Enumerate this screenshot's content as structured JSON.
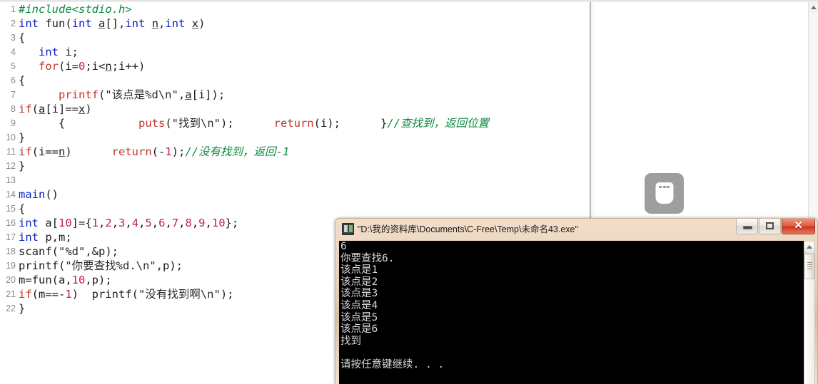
{
  "editor": {
    "name": "code-editor",
    "language": "C",
    "lines": [
      {
        "n": "1",
        "tokens": [
          {
            "t": "#include<stdio.h>",
            "c": "cmt"
          }
        ]
      },
      {
        "n": "2",
        "tokens": [
          {
            "t": "int",
            "c": "kw"
          },
          {
            "t": " fun(",
            "c": "ctext"
          },
          {
            "t": "int",
            "c": "kw"
          },
          {
            "t": " ",
            "c": "ctext"
          },
          {
            "t": "a",
            "c": "und"
          },
          {
            "t": "[],",
            "c": "ctext"
          },
          {
            "t": "int",
            "c": "kw"
          },
          {
            "t": " ",
            "c": "ctext"
          },
          {
            "t": "n",
            "c": "und"
          },
          {
            "t": ",",
            "c": "ctext"
          },
          {
            "t": "int",
            "c": "kw"
          },
          {
            "t": " ",
            "c": "ctext"
          },
          {
            "t": "x",
            "c": "und"
          },
          {
            "t": ")",
            "c": "ctext"
          }
        ]
      },
      {
        "n": "3",
        "tokens": [
          {
            "t": "{",
            "c": "ctext"
          }
        ]
      },
      {
        "n": "4",
        "tokens": [
          {
            "t": "   ",
            "c": "ctext"
          },
          {
            "t": "int",
            "c": "kw"
          },
          {
            "t": " i;",
            "c": "ctext"
          }
        ]
      },
      {
        "n": "5",
        "tokens": [
          {
            "t": "   ",
            "c": "ctext"
          },
          {
            "t": "for",
            "c": "kwr"
          },
          {
            "t": "(i=",
            "c": "ctext"
          },
          {
            "t": "0",
            "c": "num"
          },
          {
            "t": ";i<",
            "c": "ctext"
          },
          {
            "t": "n",
            "c": "und"
          },
          {
            "t": ";i++)",
            "c": "ctext"
          }
        ]
      },
      {
        "n": "6",
        "tokens": [
          {
            "t": "{",
            "c": "ctext"
          }
        ]
      },
      {
        "n": "7",
        "tokens": [
          {
            "t": "      ",
            "c": "ctext"
          },
          {
            "t": "printf",
            "c": "kwr"
          },
          {
            "t": "(",
            "c": "ctext"
          },
          {
            "t": "\"该点是%d\\n\"",
            "c": "str"
          },
          {
            "t": ",",
            "c": "ctext"
          },
          {
            "t": "a",
            "c": "und"
          },
          {
            "t": "[i]);",
            "c": "ctext"
          }
        ]
      },
      {
        "n": "8",
        "tokens": [
          {
            "t": "if",
            "c": "kwr"
          },
          {
            "t": "(",
            "c": "ctext"
          },
          {
            "t": "a",
            "c": "und"
          },
          {
            "t": "[i]==",
            "c": "ctext"
          },
          {
            "t": "x",
            "c": "und"
          },
          {
            "t": ")",
            "c": "ctext"
          }
        ]
      },
      {
        "n": "9",
        "tokens": [
          {
            "t": "      {           ",
            "c": "ctext"
          },
          {
            "t": "puts",
            "c": "kwr"
          },
          {
            "t": "(",
            "c": "ctext"
          },
          {
            "t": "\"找到\\n\"",
            "c": "str"
          },
          {
            "t": ");      ",
            "c": "ctext"
          },
          {
            "t": "return",
            "c": "kwr"
          },
          {
            "t": "(i);      ",
            "c": "ctext"
          },
          {
            "t": "}",
            "c": "ctext"
          },
          {
            "t": "//查找到，返回位置",
            "c": "cmt"
          }
        ]
      },
      {
        "n": "10",
        "tokens": [
          {
            "t": "}",
            "c": "ctext"
          }
        ]
      },
      {
        "n": "11",
        "tokens": [
          {
            "t": "if",
            "c": "kwr"
          },
          {
            "t": "(i==",
            "c": "ctext"
          },
          {
            "t": "n",
            "c": "und"
          },
          {
            "t": ")      ",
            "c": "ctext"
          },
          {
            "t": "return",
            "c": "kwr"
          },
          {
            "t": "(-",
            "c": "ctext"
          },
          {
            "t": "1",
            "c": "num"
          },
          {
            "t": ");",
            "c": "ctext"
          },
          {
            "t": "//没有找到，返回-1",
            "c": "cmt"
          }
        ]
      },
      {
        "n": "12",
        "tokens": [
          {
            "t": "}",
            "c": "ctext"
          }
        ]
      },
      {
        "n": "13",
        "tokens": [
          {
            "t": "",
            "c": "ctext"
          }
        ]
      },
      {
        "n": "14",
        "tokens": [
          {
            "t": "main",
            "c": "kw"
          },
          {
            "t": "()",
            "c": "ctext"
          }
        ]
      },
      {
        "n": "15",
        "tokens": [
          {
            "t": "{",
            "c": "ctext"
          }
        ]
      },
      {
        "n": "16",
        "tokens": [
          {
            "t": "int",
            "c": "kw"
          },
          {
            "t": " a[",
            "c": "ctext"
          },
          {
            "t": "10",
            "c": "num"
          },
          {
            "t": "]={",
            "c": "ctext"
          },
          {
            "t": "1",
            "c": "num"
          },
          {
            "t": ",",
            "c": "ctext"
          },
          {
            "t": "2",
            "c": "num"
          },
          {
            "t": ",",
            "c": "ctext"
          },
          {
            "t": "3",
            "c": "num"
          },
          {
            "t": ",",
            "c": "ctext"
          },
          {
            "t": "4",
            "c": "num"
          },
          {
            "t": ",",
            "c": "ctext"
          },
          {
            "t": "5",
            "c": "num"
          },
          {
            "t": ",",
            "c": "ctext"
          },
          {
            "t": "6",
            "c": "num"
          },
          {
            "t": ",",
            "c": "ctext"
          },
          {
            "t": "7",
            "c": "num"
          },
          {
            "t": ",",
            "c": "ctext"
          },
          {
            "t": "8",
            "c": "num"
          },
          {
            "t": ",",
            "c": "ctext"
          },
          {
            "t": "9",
            "c": "num"
          },
          {
            "t": ",",
            "c": "ctext"
          },
          {
            "t": "10",
            "c": "num"
          },
          {
            "t": "};",
            "c": "ctext"
          }
        ]
      },
      {
        "n": "17",
        "tokens": [
          {
            "t": "int",
            "c": "kw"
          },
          {
            "t": " p,m;",
            "c": "ctext"
          }
        ]
      },
      {
        "n": "18",
        "tokens": [
          {
            "t": "scanf",
            "c": "ctext"
          },
          {
            "t": "(",
            "c": "ctext"
          },
          {
            "t": "\"%d\"",
            "c": "str"
          },
          {
            "t": ",&p);",
            "c": "ctext"
          }
        ]
      },
      {
        "n": "19",
        "tokens": [
          {
            "t": "printf",
            "c": "ctext"
          },
          {
            "t": "(",
            "c": "ctext"
          },
          {
            "t": "\"你要查找%d.\\n\"",
            "c": "str"
          },
          {
            "t": ",p);",
            "c": "ctext"
          }
        ]
      },
      {
        "n": "20",
        "tokens": [
          {
            "t": "m=fun(a,",
            "c": "ctext"
          },
          {
            "t": "10",
            "c": "num"
          },
          {
            "t": ",p);",
            "c": "ctext"
          }
        ]
      },
      {
        "n": "21",
        "tokens": [
          {
            "t": "if",
            "c": "kwr"
          },
          {
            "t": "(m==-",
            "c": "ctext"
          },
          {
            "t": "1",
            "c": "num"
          },
          {
            "t": ")  printf(",
            "c": "ctext"
          },
          {
            "t": "\"没有找到啊\\n\"",
            "c": "str"
          },
          {
            "t": ");",
            "c": "ctext"
          }
        ]
      },
      {
        "n": "22",
        "tokens": [
          {
            "t": "}",
            "c": "ctext"
          }
        ]
      }
    ]
  },
  "right_panel": {
    "device_icon": "usb-drive-icon"
  },
  "ide_scrollbar": {
    "up_arrow": "scroll-up-arrow"
  },
  "console": {
    "title": "\"D:\\我的资料库\\Documents\\C-Free\\Temp\\未命名43.exe\"",
    "window_icon": "console-app-icon",
    "buttons": {
      "minimize": "minimize-button",
      "maximize": "maximize-button",
      "close_label": "✕"
    },
    "output_lines": [
      "6",
      "你要查找6.",
      "该点是1",
      "该点是2",
      "该点是3",
      "该点是4",
      "该点是5",
      "该点是6",
      "找到",
      "",
      "请按任意键继续. . ."
    ],
    "scrollbar": {
      "up_arrow": "console-scroll-up-arrow",
      "thumb": "console-scroll-thumb"
    }
  },
  "colors": {
    "keyword_blue": "#0d22c6",
    "keyword_red": "#c0392b",
    "number_red": "#c0224a",
    "comment_green": "#0c8a3e",
    "console_bg": "#000000",
    "console_fg": "#d8d8d8",
    "titlebar_beige": "#e8d0b6",
    "close_red": "#c8361c"
  }
}
